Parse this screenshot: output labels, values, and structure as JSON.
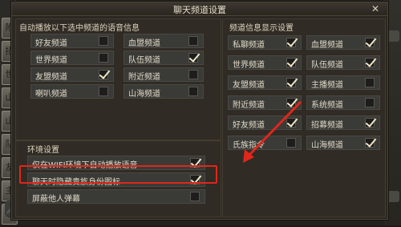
{
  "dialog": {
    "title": "聊天频道设置"
  },
  "left_panel": {
    "title": "自动播放以下选中频道的语音信息",
    "items": [
      {
        "label": "好友频道",
        "checked": false
      },
      {
        "label": "血盟频道",
        "checked": false
      },
      {
        "label": "世界频道",
        "checked": false
      },
      {
        "label": "队伍频道",
        "checked": true
      },
      {
        "label": "友盟频道",
        "checked": true
      },
      {
        "label": "附近频道",
        "checked": false
      },
      {
        "label": "喇叭频道",
        "checked": false
      },
      {
        "label": "山海频道",
        "checked": false
      }
    ]
  },
  "env_panel": {
    "title": "环境设置",
    "items": [
      {
        "label": "仅在WIFI环境下自动播放语音",
        "checked": true
      },
      {
        "label": "聊天时隐藏贵族身份图标",
        "checked": true
      },
      {
        "label": "屏蔽他人弹幕",
        "checked": false
      }
    ]
  },
  "right_panel": {
    "title": "频道信息显示设置",
    "items": [
      {
        "label": "私聊频道",
        "checked": true
      },
      {
        "label": "血盟频道",
        "checked": true
      },
      {
        "label": "世界频道",
        "checked": true
      },
      {
        "label": "队伍频道",
        "checked": true
      },
      {
        "label": "友盟频道",
        "checked": true
      },
      {
        "label": "主播频道",
        "checked": false
      },
      {
        "label": "附近频道",
        "checked": true
      },
      {
        "label": "系统频道",
        "checked": false
      },
      {
        "label": "好友频道",
        "checked": true
      },
      {
        "label": "招募频道",
        "checked": true
      },
      {
        "label": "氏族指令",
        "checked": false
      },
      {
        "label": "山海频道",
        "checked": true
      }
    ]
  },
  "background": {
    "side_tabs": [
      "附",
      "招",
      "世",
      "山",
      "山",
      "队",
      "友",
      "主",
      "系"
    ]
  },
  "colors": {
    "highlight": "#e0261b",
    "check": "#efe6c8"
  }
}
